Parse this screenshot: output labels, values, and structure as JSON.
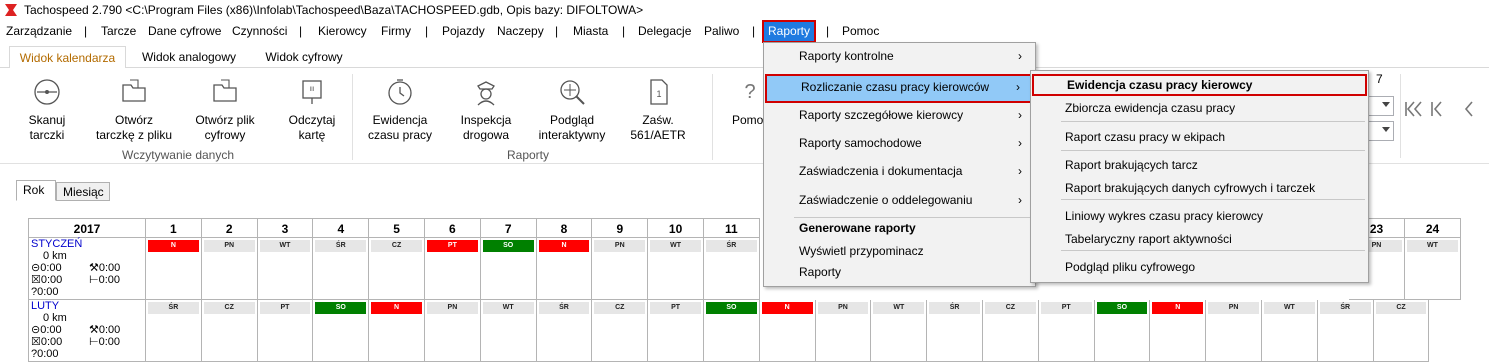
{
  "window": {
    "title": "Tachospeed 2.790 <C:\\Program Files (x86)\\Infolab\\Tachospeed\\Baza\\TACHOSPEED.gdb, Opis bazy: DIFOLTOWA>"
  },
  "menubar": {
    "items": [
      "Zarządzanie",
      "Tarcze",
      "Dane cyfrowe",
      "Czynności",
      "Kierowcy",
      "Firmy",
      "Pojazdy",
      "Naczepy",
      "Miasta",
      "Delegacje",
      "Paliwo",
      "Raporty",
      "Pomoc"
    ],
    "separator": "|"
  },
  "tabs": [
    "Widok kalendarza",
    "Widok analogowy",
    "Widok cyfrowy"
  ],
  "ribbon": {
    "buttons": [
      {
        "line1": "Skanuj",
        "line2": "tarczki",
        "icon": "disc-icon"
      },
      {
        "line1": "Otwórz",
        "line2": "tarczkę z pliku",
        "icon": "folder-icon"
      },
      {
        "line1": "Otwórz plik",
        "line2": "cyfrowy",
        "icon": "folder-icon"
      },
      {
        "line1": "Odczytaj",
        "line2": "kartę",
        "icon": "card-reader-icon"
      },
      {
        "line1": "Ewidencja",
        "line2": "czasu pracy",
        "icon": "clock-icon"
      },
      {
        "line1": "Inspekcja",
        "line2": "drogowa",
        "icon": "police-icon"
      },
      {
        "line1": "Podgląd",
        "line2": "interaktywny",
        "icon": "magnifier-icon"
      },
      {
        "line1": "Zaśw.",
        "line2": "561/AETR",
        "icon": "document-icon"
      },
      {
        "line1": "Pomoc",
        "line2": "",
        "icon": "help-icon"
      }
    ],
    "groups": [
      "Wczytywanie danych",
      "Raporty"
    ],
    "partial_digit": "7"
  },
  "year_tabs": [
    "Rok",
    "Miesiąc"
  ],
  "calendar": {
    "year": "2017",
    "days_left": [
      "1",
      "2",
      "3",
      "4",
      "5",
      "6",
      "7",
      "8",
      "9",
      "10",
      "11"
    ],
    "days_right": [
      "23",
      "24"
    ],
    "months": [
      {
        "name": "STYCZEŃ",
        "km": "0 km",
        "t1": "0:00",
        "t2": "0:00",
        "t3": "0:00",
        "t4": "0:00",
        "t5": "0:00",
        "left": [
          [
            "N",
            "red"
          ],
          [
            "PN",
            "gray"
          ],
          [
            "WT",
            "gray"
          ],
          [
            "ŚR",
            "gray"
          ],
          [
            "CZ",
            "gray"
          ],
          [
            "PT",
            "red"
          ],
          [
            "SO",
            "green"
          ],
          [
            "N",
            "red"
          ],
          [
            "PN",
            "gray"
          ],
          [
            "WT",
            "gray"
          ],
          [
            "ŚR",
            "gray"
          ]
        ],
        "right": [
          [
            "PN",
            "gray"
          ],
          [
            "WT",
            "gray"
          ]
        ],
        "right_partial": "red"
      },
      {
        "name": "LUTY",
        "km": "0 km",
        "t1": "0:00",
        "t2": "0:00",
        "t3": "0:00",
        "t4": "0:00",
        "t5": "0:00",
        "left": [
          [
            "ŚR",
            "gray"
          ],
          [
            "CZ",
            "gray"
          ],
          [
            "PT",
            "gray"
          ],
          [
            "SO",
            "green"
          ],
          [
            "N",
            "red"
          ],
          [
            "PN",
            "gray"
          ],
          [
            "WT",
            "gray"
          ],
          [
            "ŚR",
            "gray"
          ],
          [
            "CZ",
            "gray"
          ],
          [
            "PT",
            "gray"
          ],
          [
            "SO",
            "green"
          ]
        ],
        "right": [
          [
            "N",
            "red"
          ],
          [
            "PN",
            "gray"
          ],
          [
            "WT",
            "gray"
          ],
          [
            "ŚR",
            "gray"
          ],
          [
            "CZ",
            "gray"
          ],
          [
            "PT",
            "gray"
          ],
          [
            "SO",
            "green"
          ],
          [
            "N",
            "red"
          ],
          [
            "PN",
            "gray"
          ],
          [
            "WT",
            "gray"
          ],
          [
            "ŚR",
            "gray"
          ],
          [
            "CZ",
            "gray"
          ]
        ]
      }
    ]
  },
  "raporty_menu": {
    "items": [
      {
        "label": "Raporty kontrolne",
        "sub": true
      },
      {
        "label": "Rozliczanie czasu pracy kierowców",
        "sub": true,
        "highlighted": true
      },
      {
        "label": "Raporty szczegółowe kierowcy",
        "sub": true
      },
      {
        "label": "Raporty samochodowe",
        "sub": true
      },
      {
        "label": "Zaświadczenia i dokumentacja",
        "sub": true
      },
      {
        "label": "Zaświadczenie o oddelegowaniu",
        "sub": true
      },
      {
        "label": "Generowane raporty",
        "sub": false,
        "bold": true
      },
      {
        "label": "Wyświetl przypominacz",
        "sub": false
      },
      {
        "label": "Raporty",
        "sub": false
      }
    ],
    "chevron": "›"
  },
  "submenu": {
    "items": [
      "Ewidencja czasu pracy kierowcy",
      "Zbiorcza ewidencja czasu pracy",
      "Raport czasu pracy w ekipach",
      "Raport brakujących tarcz",
      "Raport brakujących danych cyfrowych i tarczek",
      "Liniowy wykres czasu pracy kierowcy",
      "Tabelaryczny raport aktywności",
      "Podgląd pliku cyfrowego"
    ]
  },
  "colors": {
    "accent": "#1f7ae0",
    "highlight_border": "#d00000",
    "menu_hover": "#91c9f7",
    "tab_active_text": "#b36b00"
  }
}
